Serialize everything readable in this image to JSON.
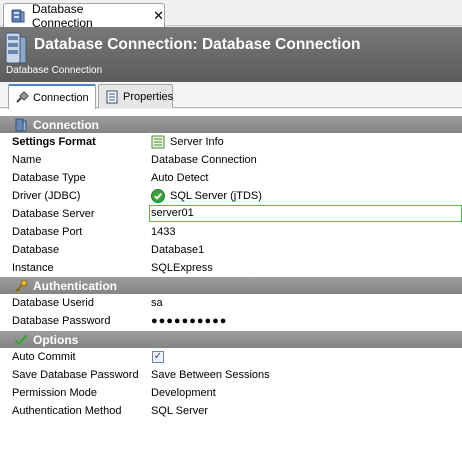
{
  "doc_tab": {
    "label": "Database Connection",
    "close": "✕"
  },
  "header": {
    "title": "Database Connection: Database Connection",
    "subtitle": "Database Connection"
  },
  "form_tabs": [
    {
      "label": "Connection",
      "active": true
    },
    {
      "label": "Properties",
      "active": false
    }
  ],
  "sections": {
    "connection": {
      "title": "Connection",
      "rows": {
        "settings_format": {
          "label": "Settings Format",
          "value": "Server Info"
        },
        "name": {
          "label": "Name",
          "value": "Database Connection"
        },
        "database_type": {
          "label": "Database Type",
          "value": "Auto Detect"
        },
        "driver": {
          "label": "Driver (JDBC)",
          "value": "SQL Server (jTDS)"
        },
        "database_server": {
          "label": "Database Server",
          "value": "server01"
        },
        "database_port": {
          "label": "Database Port",
          "value": "1433"
        },
        "database": {
          "label": "Database",
          "value": "Database1"
        },
        "instance": {
          "label": "Instance",
          "value": "SQLExpress"
        }
      }
    },
    "authentication": {
      "title": "Authentication",
      "rows": {
        "userid": {
          "label": "Database Userid",
          "value": "sa"
        },
        "password": {
          "label": "Database Password",
          "value": "●●●●●●●●●●"
        }
      }
    },
    "options": {
      "title": "Options",
      "rows": {
        "auto_commit": {
          "label": "Auto Commit",
          "value": "✓",
          "checked": true
        },
        "save_password": {
          "label": "Save Database Password",
          "value": "Save Between Sessions"
        },
        "permission_mode": {
          "label": "Permission Mode",
          "value": "Development"
        },
        "auth_method": {
          "label": "Authentication Method",
          "value": "SQL Server"
        }
      }
    }
  },
  "colors": {
    "header_bg": "#6a6a6a",
    "section_bg": "#8f8f8f",
    "edit_border": "#4cc24c",
    "active_tab_accent": "#4a87c8"
  },
  "icons": {
    "doc_tab": "database-icon",
    "header": "database-large-icon",
    "connection_tab": "connection-plug-icon",
    "properties_tab": "properties-sheet-icon",
    "connection_section": "database-icon",
    "authentication_section": "key-icon",
    "options_section": "checkmark-icon",
    "settings_format": "server-info-icon",
    "driver": "green-check-circle-icon"
  }
}
